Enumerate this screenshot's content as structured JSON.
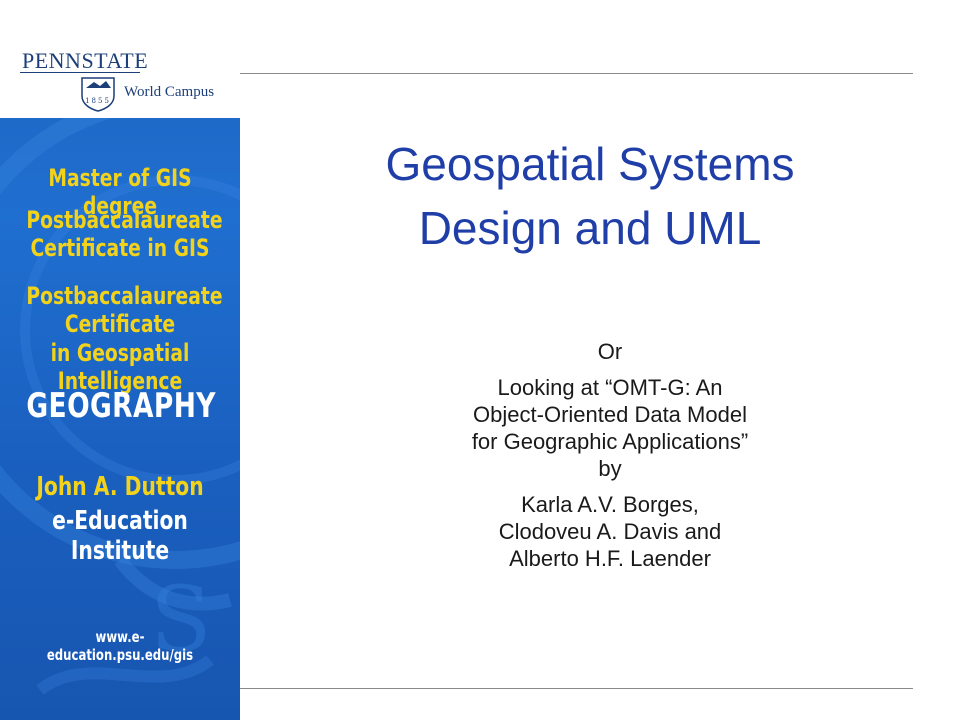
{
  "slide": {
    "title_line1": "Geospatial Systems",
    "title_line2": "Design and UML",
    "subtitle_lines": [
      "Or",
      "Looking at “OMT-G: An",
      "Object-Oriented Data Model",
      "for Geographic Applications”",
      "by",
      "Karla A.V. Borges,",
      "Clodoveu A. Davis and",
      "Alberto H.F. Laender"
    ]
  },
  "sidebar": {
    "logo_name": "PENNSTATE",
    "logo_years": "1855",
    "logo_unit": "World Campus",
    "programs": [
      "Master of GIS degree",
      "Postbaccalaureate Certificate in GIS",
      "Postbaccalaureate Certificate in Geospatial Intelligence"
    ],
    "program_lines": [
      [
        "Master of GIS degree"
      ],
      [
        "Postbaccalaureate",
        "Certificate in GIS"
      ],
      [
        "Postbaccalaureate Certificate",
        "in Geospatial Intelligence"
      ]
    ],
    "department": "GEOGRAPHY",
    "institute_line1": "John A. Dutton",
    "institute_line2": "e-Education Institute",
    "url": "www.e-education.psu.edu/gis"
  },
  "colors": {
    "sidebar_blue": "#1f6fd0",
    "accent_yellow": "#f2d21a",
    "title_blue": "#1f3ea8",
    "logo_navy": "#1c3f7a"
  }
}
